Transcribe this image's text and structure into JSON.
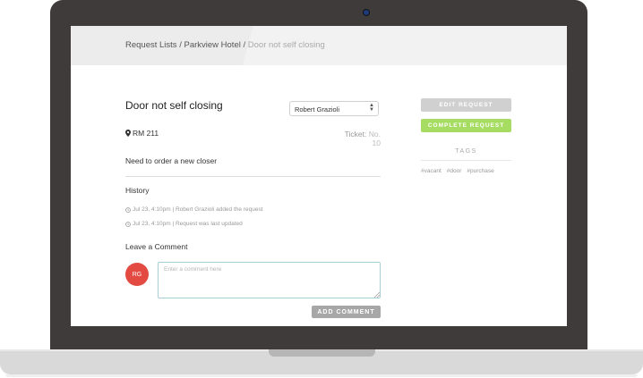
{
  "breadcrumb": {
    "request_lists": "Request Lists",
    "separator1": " / ",
    "hotel": "Parkview Hotel",
    "separator2": " / ",
    "current": "Door not self closing"
  },
  "request": {
    "title": "Door not self closing",
    "assignee": "Robert Grazioli",
    "room": "RM 211",
    "ticket_label": "Ticket:",
    "ticket_number": "No. 10",
    "description": "Need to order a new closer"
  },
  "history": {
    "title": "History",
    "items": [
      {
        "text": "Jul 23, 4:10pm | Robert Grazioli added the request"
      },
      {
        "text": "Jul 23, 4:10pm | Request was last updated"
      }
    ]
  },
  "comment": {
    "title": "Leave a Comment",
    "avatar_initials": "RG",
    "placeholder": "Enter a comment here",
    "value": "",
    "add_button": "ADD COMMENT"
  },
  "actions": {
    "edit_button": "EDIT REQUEST",
    "complete_button": "COMPLETE REQUEST"
  },
  "tags": {
    "title": "TAGS",
    "items": [
      "#vacant",
      "#door",
      "#purchase"
    ]
  },
  "colors": {
    "avatar": "#e24a42",
    "complete": "#a6dc62",
    "edit": "#d0d0d0",
    "add_comment": "#a7a7a7",
    "bezel": "#3f3b3a"
  },
  "icons": {
    "room": "map-pin-icon",
    "history": "clock-icon",
    "camera": "camera-icon",
    "select": "select-arrows-icon"
  }
}
